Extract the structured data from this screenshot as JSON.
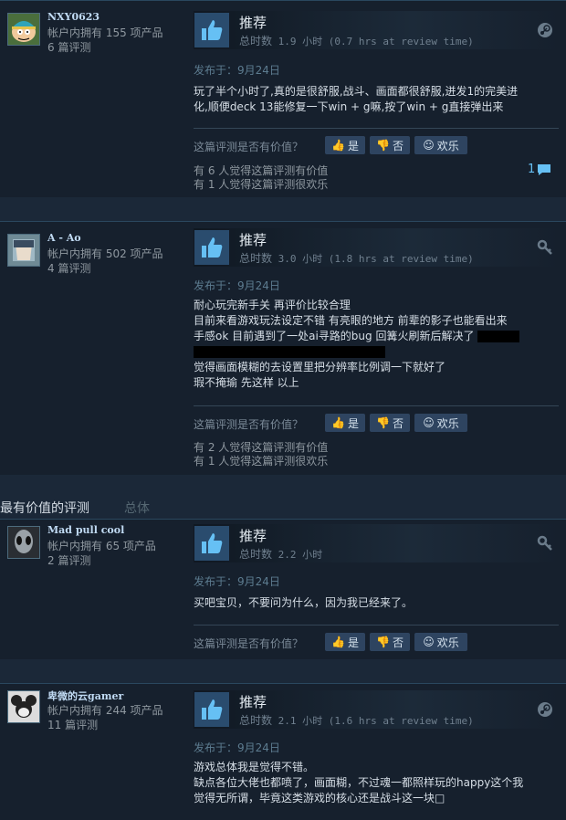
{
  "colors": {
    "background": "#1b2838",
    "review_bg": "#16202d",
    "accent": "#66c0f4",
    "button_bg": "#2e4460"
  },
  "ui": {
    "helpful_question": "这篇评测是否有价值？",
    "yes": "是",
    "no": "否",
    "funny": "欢乐",
    "recommended": "推荐",
    "hours_prefix": "总时数"
  },
  "section": {
    "title": "最有价值的评测",
    "subtitle": "总体"
  },
  "reviews": [
    {
      "author": "NXY0623",
      "products": "帐户内拥有 155 项产品",
      "reviews_count": "6 篇评测",
      "avatar": "cartman-avatar",
      "hours": "1.9 小时 (0.7 hrs at review time)",
      "posted": "发布于：9月24日",
      "lines": [
        "玩了半个小时了,真的是很舒服,战斗、画面都很舒服,迸发1的完美进",
        "化,顺便deck 13能修复一下win + g嘛,按了win + g直接弹出来"
      ],
      "stat_helpful": "有 6 人觉得这篇评测有价值",
      "stat_funny": "有 1 人觉得这篇评测很欢乐",
      "comments": "1",
      "corner_icon": "steam-icon"
    },
    {
      "author": "A - Ao",
      "products": "帐户内拥有 502 项产品",
      "reviews_count": "4 篇评测",
      "avatar": "anime-avatar",
      "hours": "3.0 小时 (1.8 hrs at review time)",
      "posted": "发布于：9月24日",
      "lines": [
        "耐心玩完新手关 再评价比较合理",
        "目前来看游戏玩法设定不错 有亮眼的地方 前辈的影子也能看出来",
        "手感ok 目前遇到了一处ai寻路的bug 回篝火刷新后解决了",
        "",
        "觉得画面模糊的去设置里把分辨率比例调一下就好了",
        "瑕不掩瑜 先这样 以上"
      ],
      "stat_helpful": "有 2 人觉得这篇评测有价值",
      "stat_funny": "有 1 人觉得这篇评测很欢乐",
      "corner_icon": "key-icon"
    },
    {
      "author": "Mad pull cool",
      "products": "帐户内拥有 65 项产品",
      "reviews_count": "2 篇评测",
      "avatar": "alien-avatar",
      "hours": "2.2 小时",
      "posted": "发布于：9月24日",
      "lines": [
        "买吧宝贝，不要问为什么，因为我已经来了。"
      ],
      "corner_icon": "key-icon"
    },
    {
      "author": "卑微的云gamer",
      "products": "帐户内拥有 244 项产品",
      "reviews_count": "11 篇评测",
      "avatar": "mickey-avatar",
      "hours": "2.1 小时 (1.6 hrs at review time)",
      "posted": "发布于：9月24日",
      "lines": [
        "游戏总体我是觉得不错。",
        "缺点各位大佬也都喷了，画面糊，不过魂一都照样玩的happy这个我",
        "觉得无所谓，毕竟这类游戏的核心还是战斗这一块□"
      ],
      "corner_icon": "steam-icon"
    }
  ]
}
